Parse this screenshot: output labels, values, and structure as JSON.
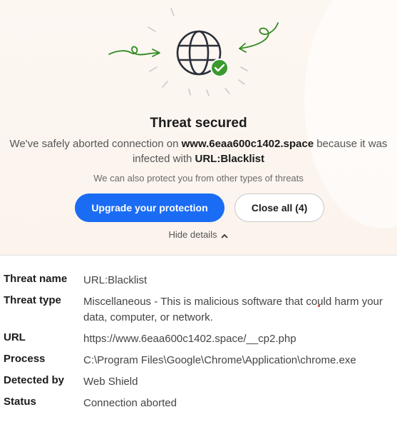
{
  "header": {
    "title": "Threat secured",
    "message_prefix": "We've safely aborted connection on ",
    "domain": "www.6eaa600c1402.space",
    "message_middle": " because it was infected with ",
    "threat": "URL:Blacklist",
    "subtext": "We can also protect you from other types of threats"
  },
  "buttons": {
    "upgrade_label": "Upgrade your protection",
    "close_label": "Close all (4)"
  },
  "toggle": {
    "hide_details_label": "Hide details"
  },
  "details": [
    {
      "label": "Threat name",
      "value": "URL:Blacklist"
    },
    {
      "label": "Threat type",
      "value": "Miscellaneous - This is malicious software that could harm your data, computer, or network."
    },
    {
      "label": "URL",
      "value": "https://www.6eaa600c1402.space/__cp2.php"
    },
    {
      "label": "Process",
      "value": "C:\\Program Files\\Google\\Chrome\\Application\\chrome.exe"
    },
    {
      "label": "Detected by",
      "value": "Web Shield"
    },
    {
      "label": "Status",
      "value": "Connection aborted"
    }
  ],
  "colors": {
    "primary_blue": "#1a6cf5",
    "success_green": "#3a9a2e",
    "arrow_green": "#2e8a1f"
  },
  "icons": [
    "globe-icon",
    "checkmark-badge-icon",
    "swirl-arrow-icon",
    "chevron-up-icon"
  ]
}
